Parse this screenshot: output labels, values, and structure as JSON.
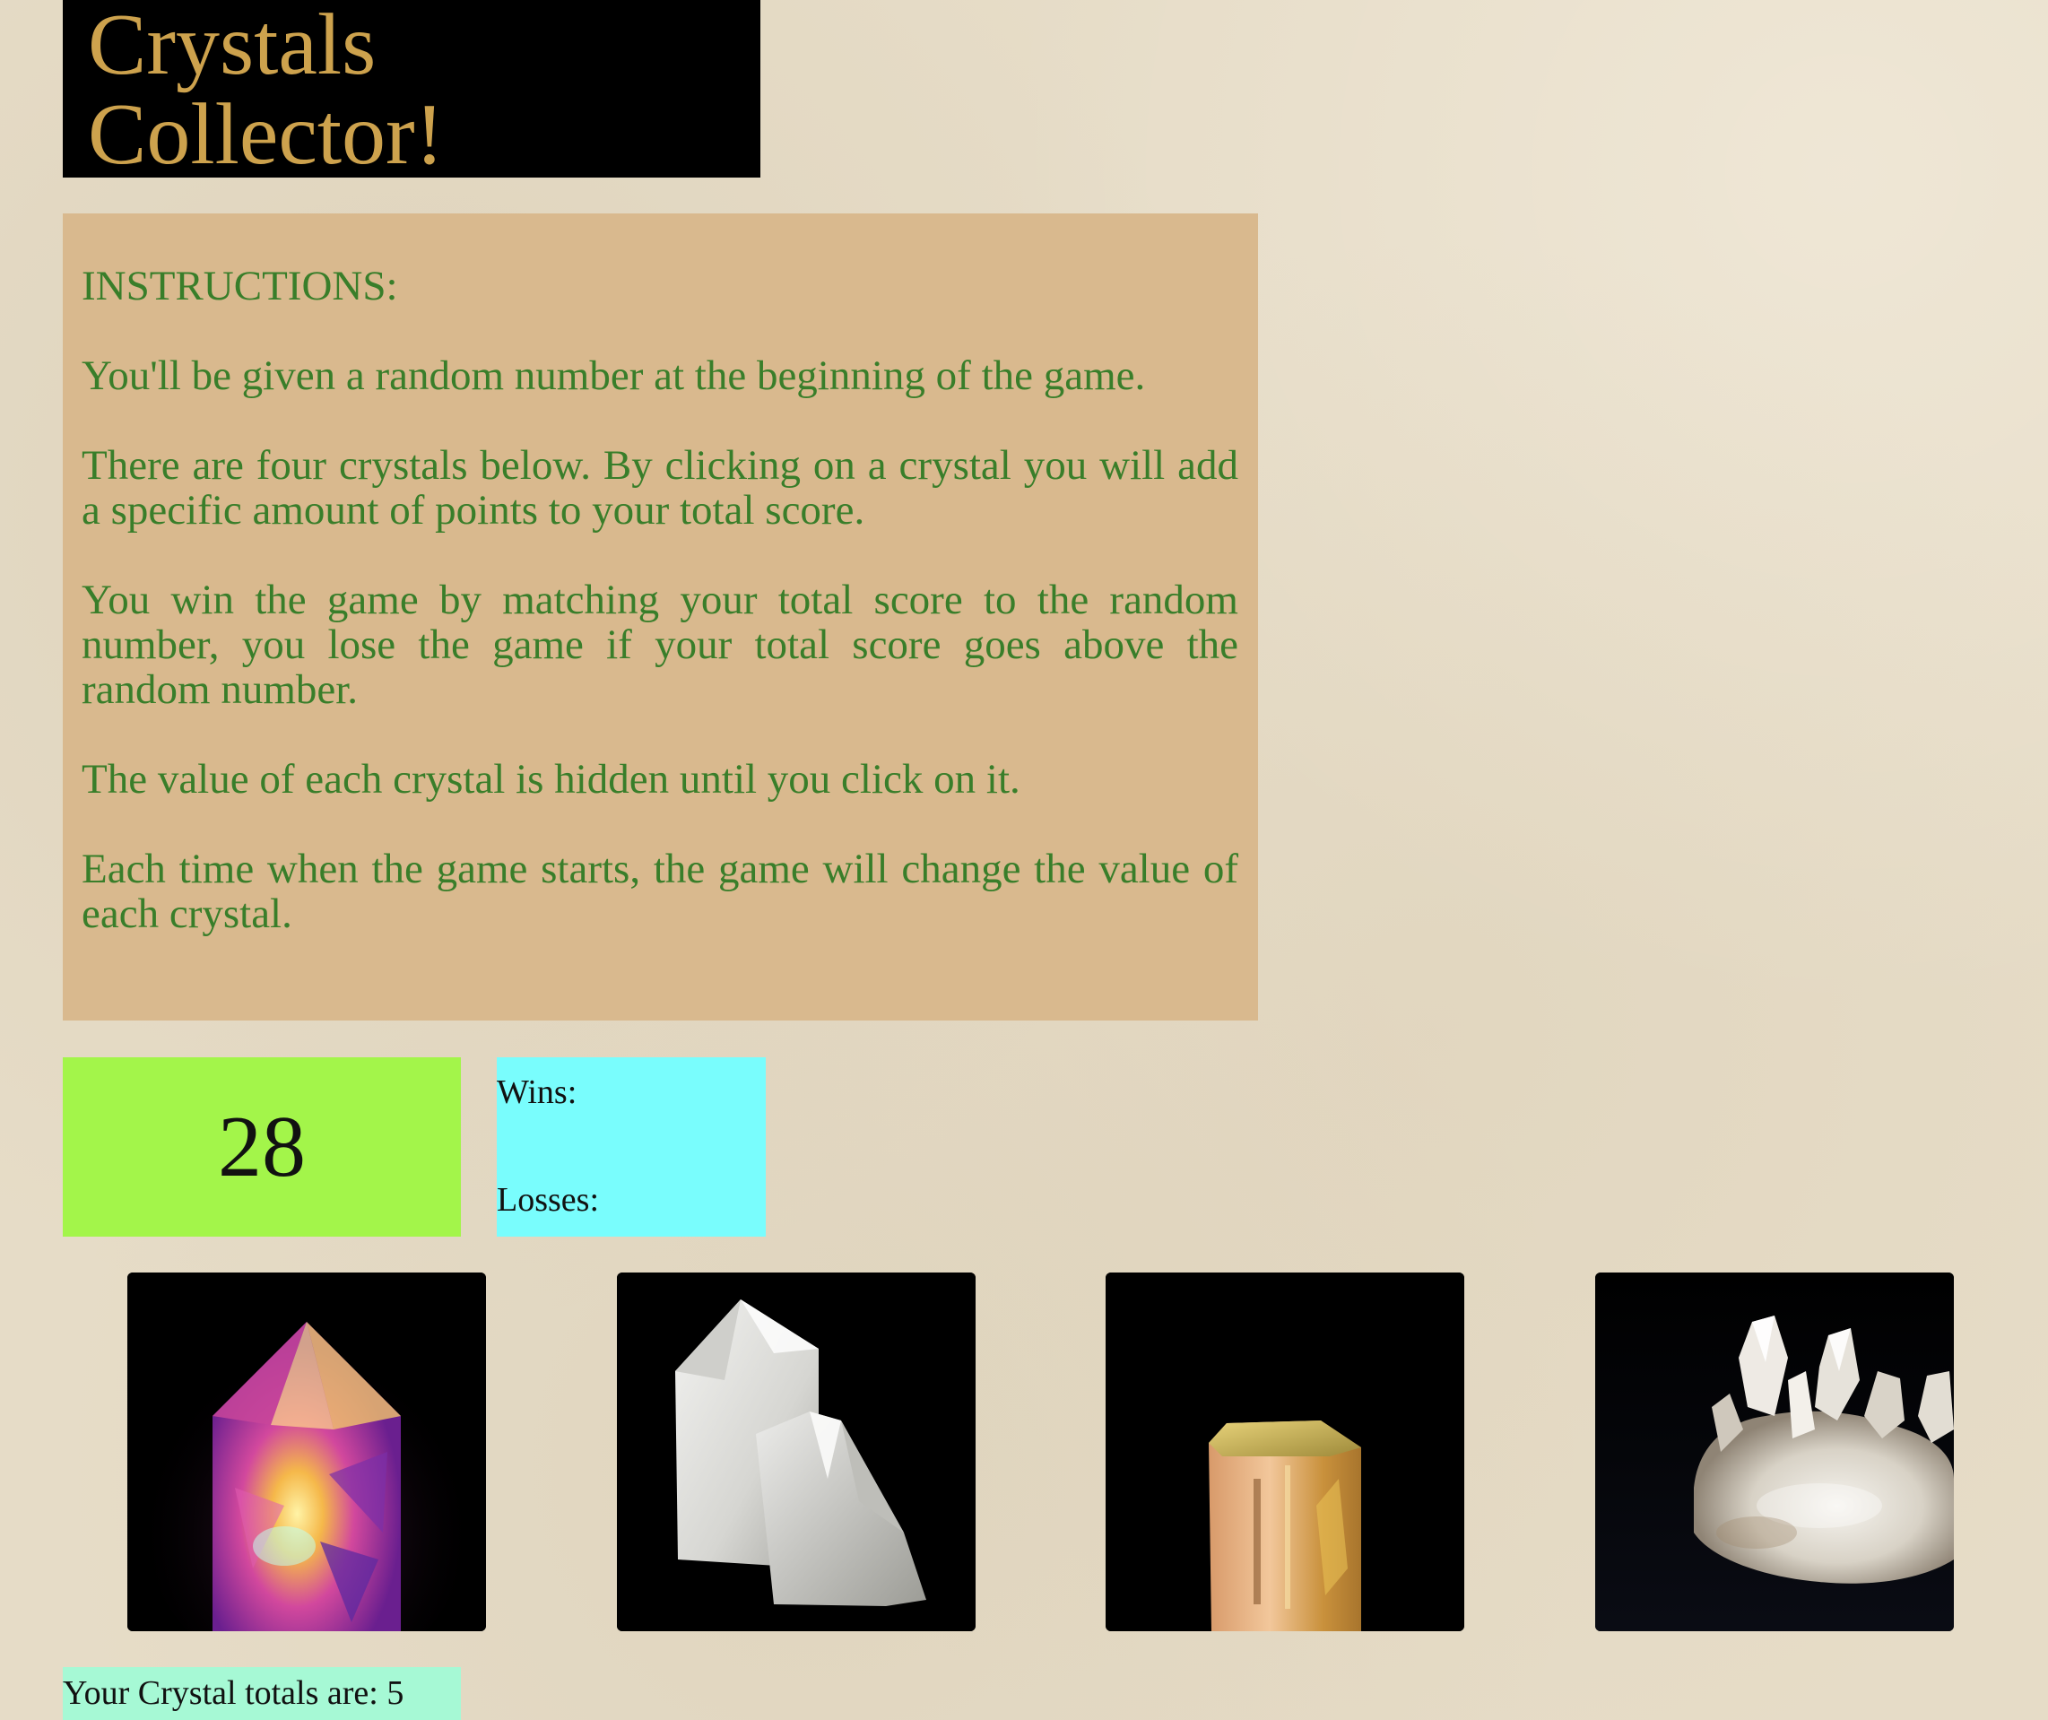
{
  "header": {
    "title_line1": "Crystals",
    "title_line2": "Collector!"
  },
  "instructions": {
    "heading": "INSTRUCTIONS:",
    "paragraphs": [
      "You'll be given a random number at the beginning of the game.",
      "There are four crystals below. By clicking on a crystal you will add a specific amount of points to your total score.",
      "You win the game by matching your total score to the random number, you lose the game if your total score goes above the random number.",
      "The value of each crystal is hidden until you click on it.",
      "Each time when the game starts, the game will change the value of each crystal."
    ]
  },
  "game": {
    "target_number": "28",
    "wins_label": "Wins:",
    "losses_label": "Losses:",
    "totals_text": "Your Crystal totals are: 5"
  },
  "crystals": [
    {
      "icon": "amethyst-crystal-icon"
    },
    {
      "icon": "white-quartz-crystal-icon"
    },
    {
      "icon": "topaz-crystal-icon"
    },
    {
      "icon": "quartz-cluster-crystal-icon"
    }
  ],
  "colors": {
    "page_background": "#e6dcc7",
    "title_background": "#000000",
    "title_text": "#cda24d",
    "instructions_background": "#d9b98e",
    "instructions_text": "#397e2a",
    "target_background": "#a3f54a",
    "score_background": "#79fdfd",
    "totals_background": "#a6f9d5"
  }
}
